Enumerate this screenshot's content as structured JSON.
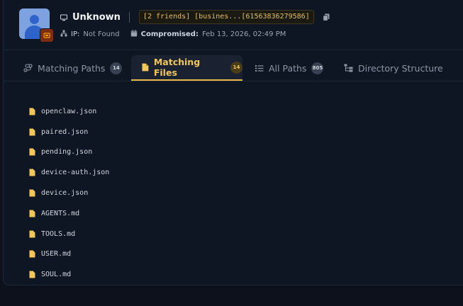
{
  "header": {
    "name": "Unknown",
    "tag": "[2 friends] [busines...[61563836279586]",
    "ip_label": "IP:",
    "ip_value": "Not Found",
    "compromised_label": "Compromised:",
    "compromised_value": "Feb 13, 2026, 02:49 PM"
  },
  "tabs": [
    {
      "label": "Matching Paths",
      "count": "14",
      "icon": "route-icon"
    },
    {
      "label": "Matching Files",
      "count": "14",
      "icon": "file-icon"
    },
    {
      "label": "All Paths",
      "count": "805",
      "icon": "list-icon"
    },
    {
      "label": "Directory Structure",
      "icon": "sitemap-icon"
    }
  ],
  "active_tab": "Matching Files",
  "files": [
    "openclaw.json",
    "paired.json",
    "pending.json",
    "device-auth.json",
    "device.json",
    "AGENTS.md",
    "TOOLS.md",
    "USER.md",
    "SOUL.md"
  ],
  "colors": {
    "accent": "#e8b948",
    "background": "#0f1623"
  }
}
